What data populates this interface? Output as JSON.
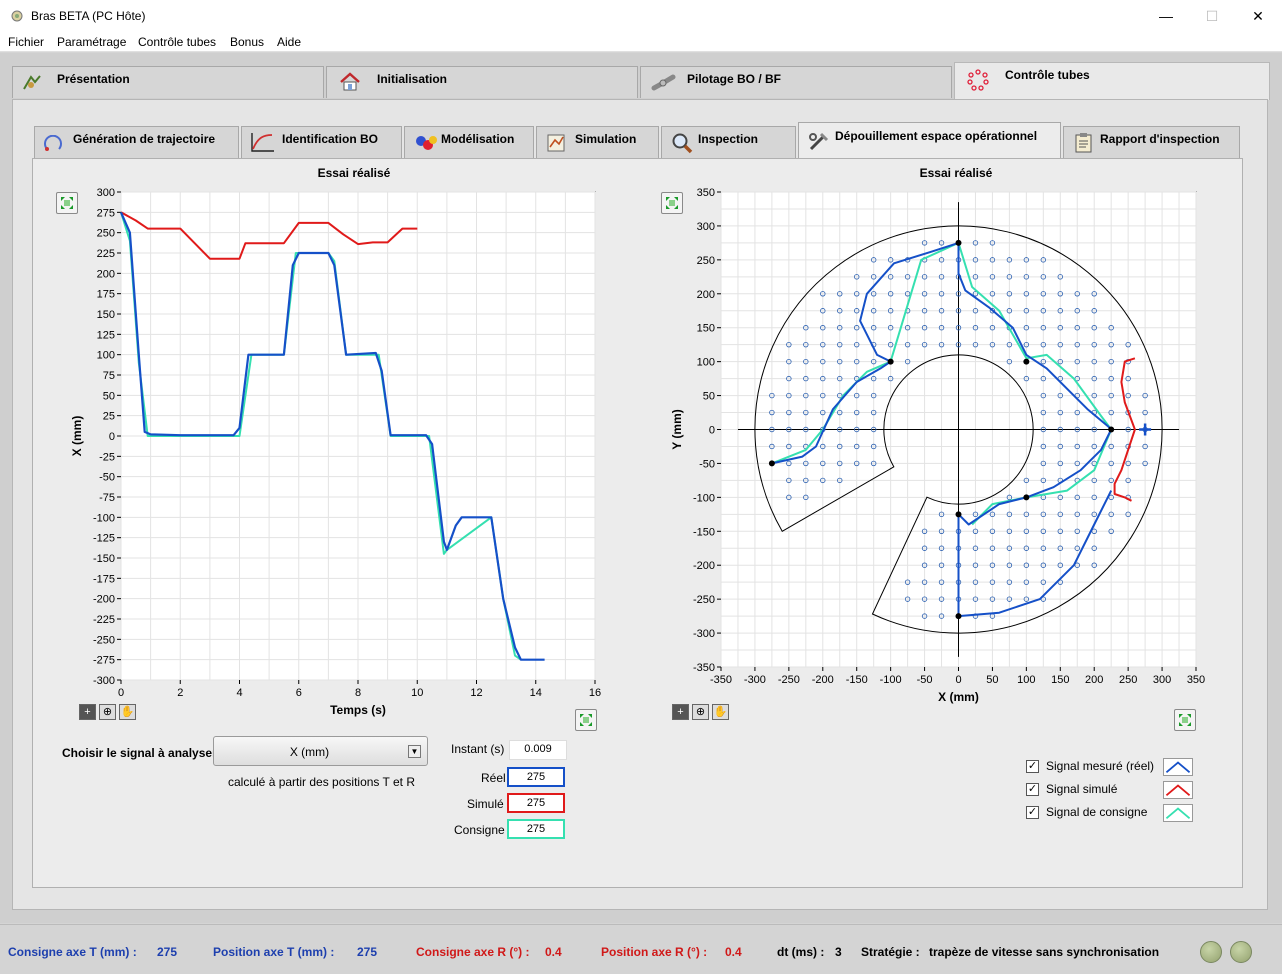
{
  "window": {
    "title": "Bras BETA (PC Hôte)"
  },
  "menu": [
    "Fichier",
    "Paramétrage",
    "Contrôle tubes",
    "Bonus",
    "Aide"
  ],
  "top_tabs": [
    "Présentation",
    "Initialisation",
    "Pilotage BO / BF",
    "Contrôle tubes"
  ],
  "sub_tabs": [
    "Génération de trajectoire",
    "Identification BO",
    "Modélisation",
    "Simulation",
    "Inspection",
    "Dépouillement espace opérationnel",
    "Rapport d'inspection"
  ],
  "left_chart": {
    "title": "Essai réalisé",
    "xlabel": "Temps (s)",
    "ylabel": "X (mm)",
    "xticks": [
      "0",
      "2",
      "4",
      "6",
      "8",
      "10",
      "12",
      "14",
      "16"
    ],
    "yticks": [
      "300",
      "275",
      "250",
      "225",
      "200",
      "175",
      "150",
      "125",
      "100",
      "75",
      "50",
      "25",
      "0",
      "-25",
      "-50",
      "-75",
      "-100",
      "-125",
      "-150",
      "-175",
      "-200",
      "-225",
      "-250",
      "-275",
      "-300"
    ]
  },
  "right_chart": {
    "title": "Essai réalisé",
    "xlabel": "X (mm)",
    "ylabel": "Y (mm)",
    "xticks": [
      "-350",
      "-300",
      "-250",
      "-200",
      "-150",
      "-100",
      "-50",
      "0",
      "50",
      "100",
      "150",
      "200",
      "250",
      "300",
      "350"
    ],
    "yticks": [
      "350",
      "300",
      "250",
      "200",
      "150",
      "100",
      "50",
      "0",
      "-50",
      "-100",
      "-150",
      "-200",
      "-250",
      "-300",
      "-350"
    ]
  },
  "controls": {
    "signal_label": "Choisir le signal à analyser :",
    "signal_value": "X (mm)",
    "signal_note": "calculé à partir des positions T et R",
    "instant_label": "Instant (s)",
    "instant_value": "0.009",
    "reel_label": "Réel",
    "reel_value": "275",
    "simule_label": "Simulé",
    "simule_value": "275",
    "consigne_label": "Consigne",
    "consigne_value": "275"
  },
  "legend": [
    {
      "label": "Signal mesuré (réel)",
      "color": "#1550c8"
    },
    {
      "label": "Signal simulé",
      "color": "#e01a1a"
    },
    {
      "label": "Signal de consigne",
      "color": "#35e0b0"
    }
  ],
  "status": {
    "consigne_t_label": "Consigne axe T (mm) :",
    "consigne_t_value": "275",
    "position_t_label": "Position axe T (mm) :",
    "position_t_value": "275",
    "consigne_r_label": "Consigne axe R (°) :",
    "consigne_r_value": "0.4",
    "position_r_label": "Position axe R (°) :",
    "position_r_value": "0.4",
    "dt_label": "dt (ms) :",
    "dt_value": "3",
    "strategie_label": "Stratégie :",
    "strategie_value": "trapèze de vitesse sans synchronisation"
  },
  "chart_data": [
    {
      "type": "line",
      "title": "Essai réalisé",
      "xlabel": "Temps (s)",
      "ylabel": "X (mm)",
      "xlim": [
        0,
        16
      ],
      "ylim": [
        -300,
        300
      ],
      "grid": true,
      "series": [
        {
          "name": "Signal mesuré (réel)",
          "color": "#1550c8",
          "x": [
            0,
            0.3,
            0.6,
            0.8,
            1,
            2,
            3.8,
            4,
            4.3,
            5.5,
            5.8,
            6,
            7,
            7.2,
            7.6,
            8.6,
            8.8,
            9.1,
            10.3,
            10.5,
            10.9,
            11,
            11.3,
            11.5,
            12.5,
            12.9,
            13.3,
            13.5,
            14.3
          ],
          "y": [
            275,
            250,
            100,
            5,
            2,
            1,
            1,
            10,
            100,
            100,
            210,
            225,
            225,
            210,
            100,
            102,
            80,
            1,
            1,
            -10,
            -130,
            -140,
            -110,
            -100,
            -100,
            -200,
            -260,
            -275,
            -275
          ]
        },
        {
          "name": "Signal simulé",
          "color": "#e01a1a",
          "x": [
            0,
            0.5,
            0.9,
            1.1,
            2,
            3,
            4,
            4.2,
            5.5,
            6,
            7,
            7.5,
            8,
            8.5,
            9,
            9.5,
            10
          ],
          "y": [
            275,
            265,
            255,
            255,
            255,
            218,
            218,
            237,
            237,
            262,
            262,
            248,
            236,
            238,
            238,
            255,
            255
          ]
        },
        {
          "name": "Signal de consigne",
          "color": "#35e0b0",
          "x": [
            0,
            0.3,
            0.6,
            0.9,
            2,
            4,
            4.4,
            5.5,
            5.9,
            6.1,
            7,
            7.2,
            7.6,
            8.7,
            9.1,
            10.4,
            10.9,
            11,
            12.5,
            12.9,
            13.3,
            13.5
          ],
          "y": [
            275,
            240,
            90,
            0,
            0,
            0,
            100,
            100,
            225,
            225,
            225,
            215,
            100,
            100,
            0,
            0,
            -145,
            -140,
            -100,
            -200,
            -270,
            -275
          ]
        }
      ]
    },
    {
      "type": "scatter",
      "title": "Essai réalisé",
      "xlabel": "X (mm)",
      "ylabel": "Y (mm)",
      "xlim": [
        -350,
        350
      ],
      "ylim": [
        -350,
        350
      ],
      "grid": true,
      "series": [
        {
          "name": "Signal mesuré (réel)",
          "color": "#1550c8",
          "x": [
            -275,
            -230,
            -210,
            -185,
            -150,
            -115,
            -100,
            -120,
            -145,
            -135,
            -95,
            -40,
            0,
            0,
            10,
            45,
            80,
            100,
            130,
            160,
            190,
            220,
            225,
            210,
            180,
            140,
            100,
            60,
            15,
            0,
            0,
            0,
            60,
            120,
            170,
            200,
            225
          ],
          "y": [
            -50,
            -40,
            -25,
            30,
            70,
            90,
            100,
            110,
            160,
            200,
            245,
            262,
            275,
            230,
            205,
            180,
            150,
            110,
            90,
            60,
            30,
            5,
            0,
            -30,
            -60,
            -85,
            -100,
            -110,
            -140,
            -125,
            -200,
            -275,
            -270,
            -250,
            -200,
            -140,
            -90
          ]
        },
        {
          "name": "Signal simulé",
          "color": "#e01a1a",
          "x": [
            260,
            245,
            240,
            245,
            260,
            250,
            240,
            230,
            230,
            245,
            255
          ],
          "y": [
            105,
            100,
            70,
            40,
            0,
            -30,
            -60,
            -80,
            -95,
            -100,
            -105
          ]
        },
        {
          "name": "Signal de consigne",
          "color": "#35e0b0",
          "x": [
            -275,
            -225,
            -200,
            -170,
            -135,
            -100,
            -55,
            0,
            20,
            60,
            100,
            130,
            170,
            210,
            225,
            200,
            160,
            100,
            50,
            20
          ],
          "y": [
            -50,
            -30,
            0,
            50,
            85,
            100,
            250,
            275,
            210,
            175,
            105,
            110,
            75,
            20,
            0,
            -60,
            -90,
            -100,
            -110,
            -140
          ]
        }
      ]
    }
  ]
}
